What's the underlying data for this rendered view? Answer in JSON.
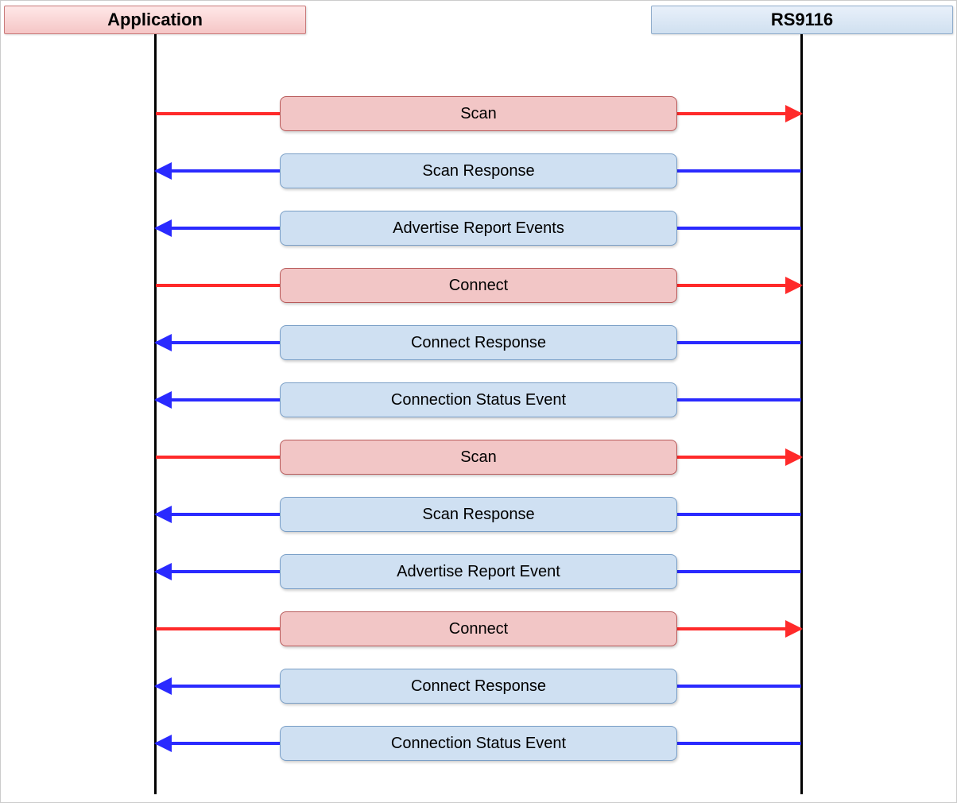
{
  "participants": {
    "left": "Application",
    "right": "RS9116"
  },
  "messages": [
    {
      "label": "Scan",
      "direction": "right",
      "color": "red"
    },
    {
      "label": "Scan Response",
      "direction": "left",
      "color": "blue"
    },
    {
      "label": "Advertise Report Events",
      "direction": "left",
      "color": "blue"
    },
    {
      "label": "Connect",
      "direction": "right",
      "color": "red"
    },
    {
      "label": "Connect Response",
      "direction": "left",
      "color": "blue"
    },
    {
      "label": "Connection Status Event",
      "direction": "left",
      "color": "blue"
    },
    {
      "label": "Scan",
      "direction": "right",
      "color": "red"
    },
    {
      "label": "Scan Response",
      "direction": "left",
      "color": "blue"
    },
    {
      "label": "Advertise Report Event",
      "direction": "left",
      "color": "blue"
    },
    {
      "label": "Connect",
      "direction": "right",
      "color": "red"
    },
    {
      "label": "Connect Response",
      "direction": "left",
      "color": "blue"
    },
    {
      "label": "Connection Status Event",
      "direction": "left",
      "color": "blue"
    }
  ],
  "layout": {
    "startY": 120,
    "stepY": 72
  }
}
